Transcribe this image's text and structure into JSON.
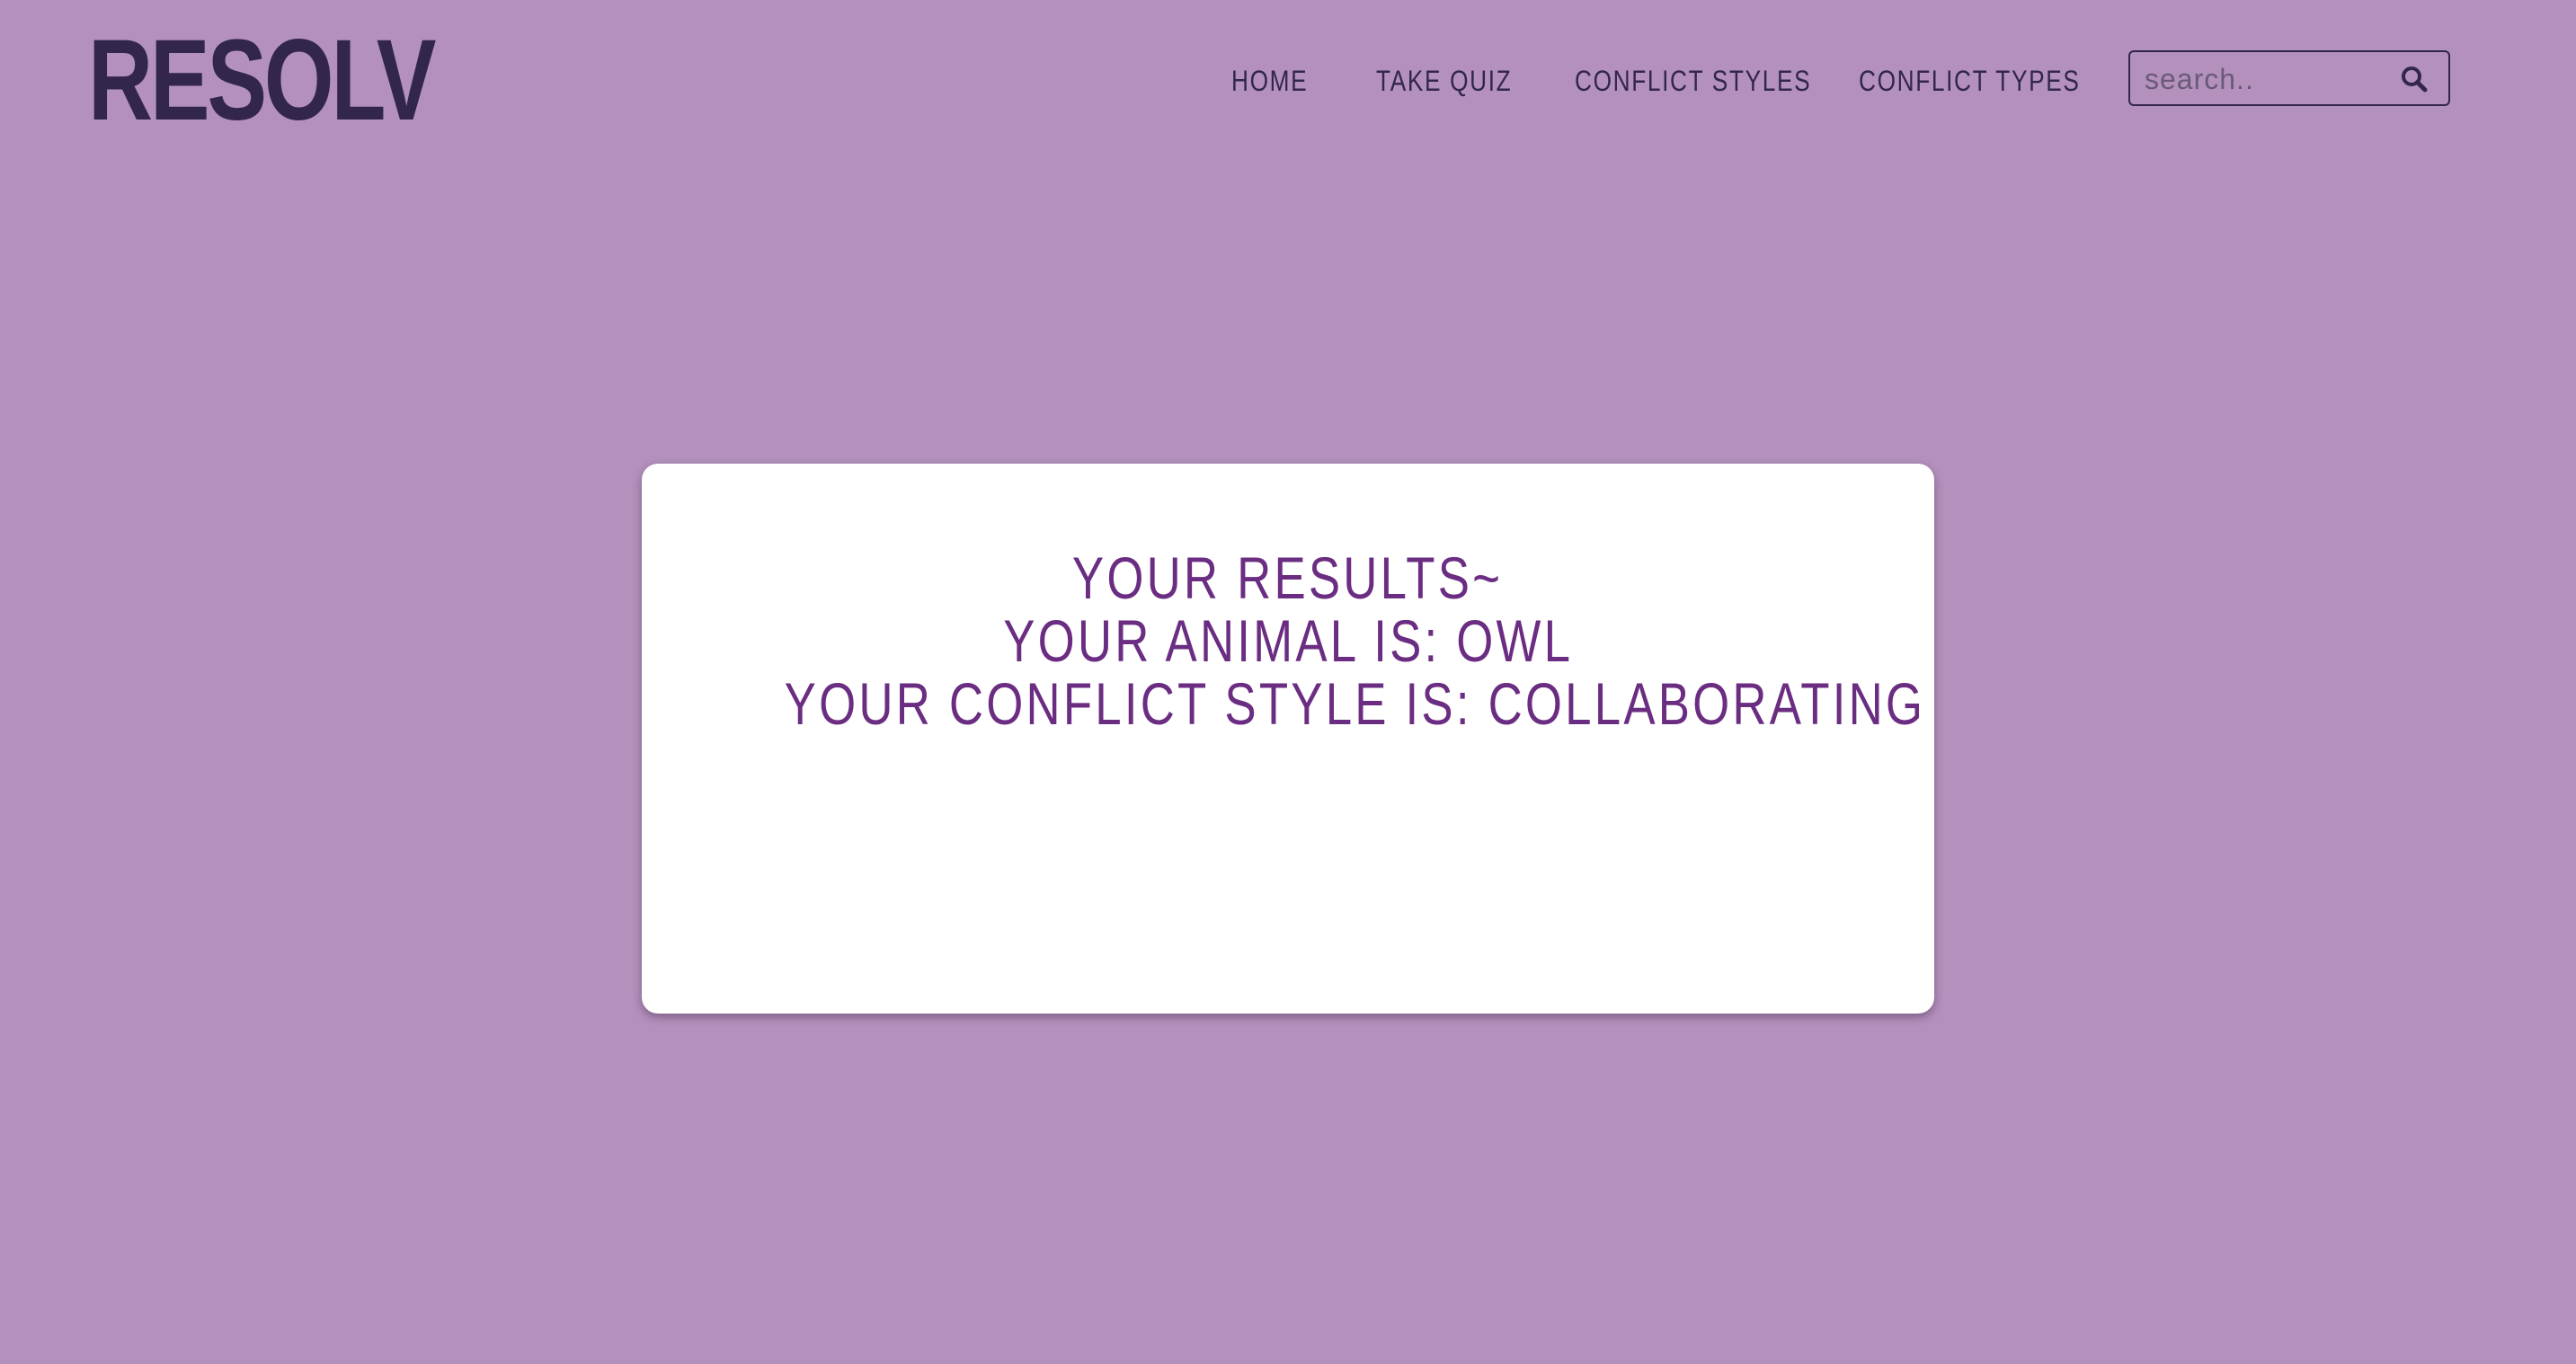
{
  "header": {
    "logo": "RESOLV",
    "nav": [
      "HOME",
      "TAKE QUIZ",
      "CONFLICT STYLES",
      "CONFLICT TYPES"
    ],
    "search": {
      "placeholder": "search..",
      "value": "",
      "icon": "search-icon"
    }
  },
  "results": {
    "heading": "YOUR RESULTS~",
    "animal_line": "YOUR ANIMAL IS: OWL",
    "style_line": "YOUR CONFLICT STYLE IS: COLLABORATING"
  },
  "colors": {
    "background": "#b391bc",
    "dark": "#33264d",
    "accent": "#6b2d82",
    "card": "#ffffff"
  }
}
